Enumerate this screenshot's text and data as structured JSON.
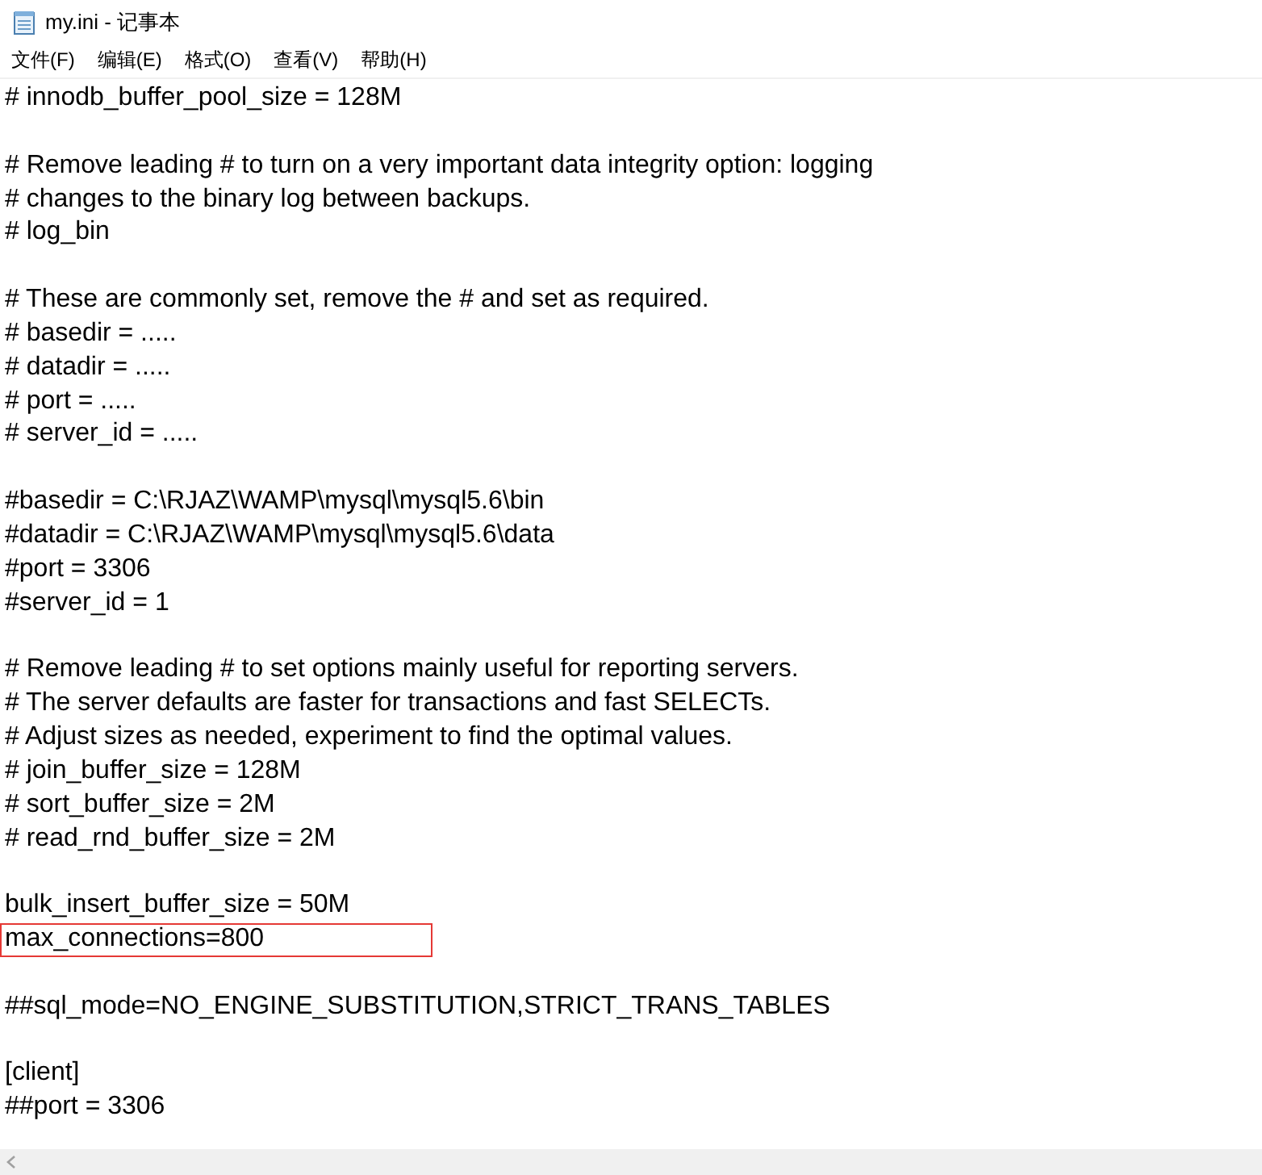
{
  "window": {
    "title": "my.ini - 记事本"
  },
  "menu": [
    "文件(F)",
    "编辑(E)",
    "格式(O)",
    "查看(V)",
    "帮助(H)"
  ],
  "editor": {
    "blocks": [
      [
        {
          "text": "# innodb_buffer_pool_size = 128M",
          "highlighted": false
        }
      ],
      [
        {
          "text": "# Remove leading # to turn on a very important data integrity option: logging",
          "highlighted": false
        },
        {
          "text": "# changes to the binary log between backups.",
          "highlighted": false
        },
        {
          "text": "# log_bin",
          "highlighted": false
        }
      ],
      [
        {
          "text": "# These are commonly set, remove the # and set as required.",
          "highlighted": false
        },
        {
          "text": "# basedir = .....",
          "highlighted": false
        },
        {
          "text": "# datadir = .....",
          "highlighted": false
        },
        {
          "text": "# port = .....",
          "highlighted": false
        },
        {
          "text": "# server_id = .....",
          "highlighted": false
        }
      ],
      [
        {
          "text": "#basedir = C:\\RJAZ\\WAMP\\mysql\\mysql5.6\\bin",
          "highlighted": false
        },
        {
          "text": "#datadir = C:\\RJAZ\\WAMP\\mysql\\mysql5.6\\data",
          "highlighted": false
        },
        {
          "text": "#port = 3306",
          "highlighted": false
        },
        {
          "text": "#server_id = 1",
          "highlighted": false
        }
      ],
      [
        {
          "text": "# Remove leading # to set options mainly useful for reporting servers.",
          "highlighted": false
        },
        {
          "text": "# The server defaults are faster for transactions and fast SELECTs.",
          "highlighted": false
        },
        {
          "text": "# Adjust sizes as needed, experiment to find the optimal values.",
          "highlighted": false
        },
        {
          "text": "# join_buffer_size = 128M",
          "highlighted": false
        },
        {
          "text": "# sort_buffer_size = 2M",
          "highlighted": false
        },
        {
          "text": "# read_rnd_buffer_size = 2M",
          "highlighted": false
        }
      ],
      [
        {
          "text": "bulk_insert_buffer_size = 50M",
          "highlighted": false
        },
        {
          "text": "max_connections=800",
          "highlighted": true
        }
      ],
      [
        {
          "text": "##sql_mode=NO_ENGINE_SUBSTITUTION,STRICT_TRANS_TABLES",
          "highlighted": false
        }
      ],
      [
        {
          "text": "[client]",
          "highlighted": false
        },
        {
          "text": "##port = 3306",
          "highlighted": false
        }
      ]
    ]
  }
}
